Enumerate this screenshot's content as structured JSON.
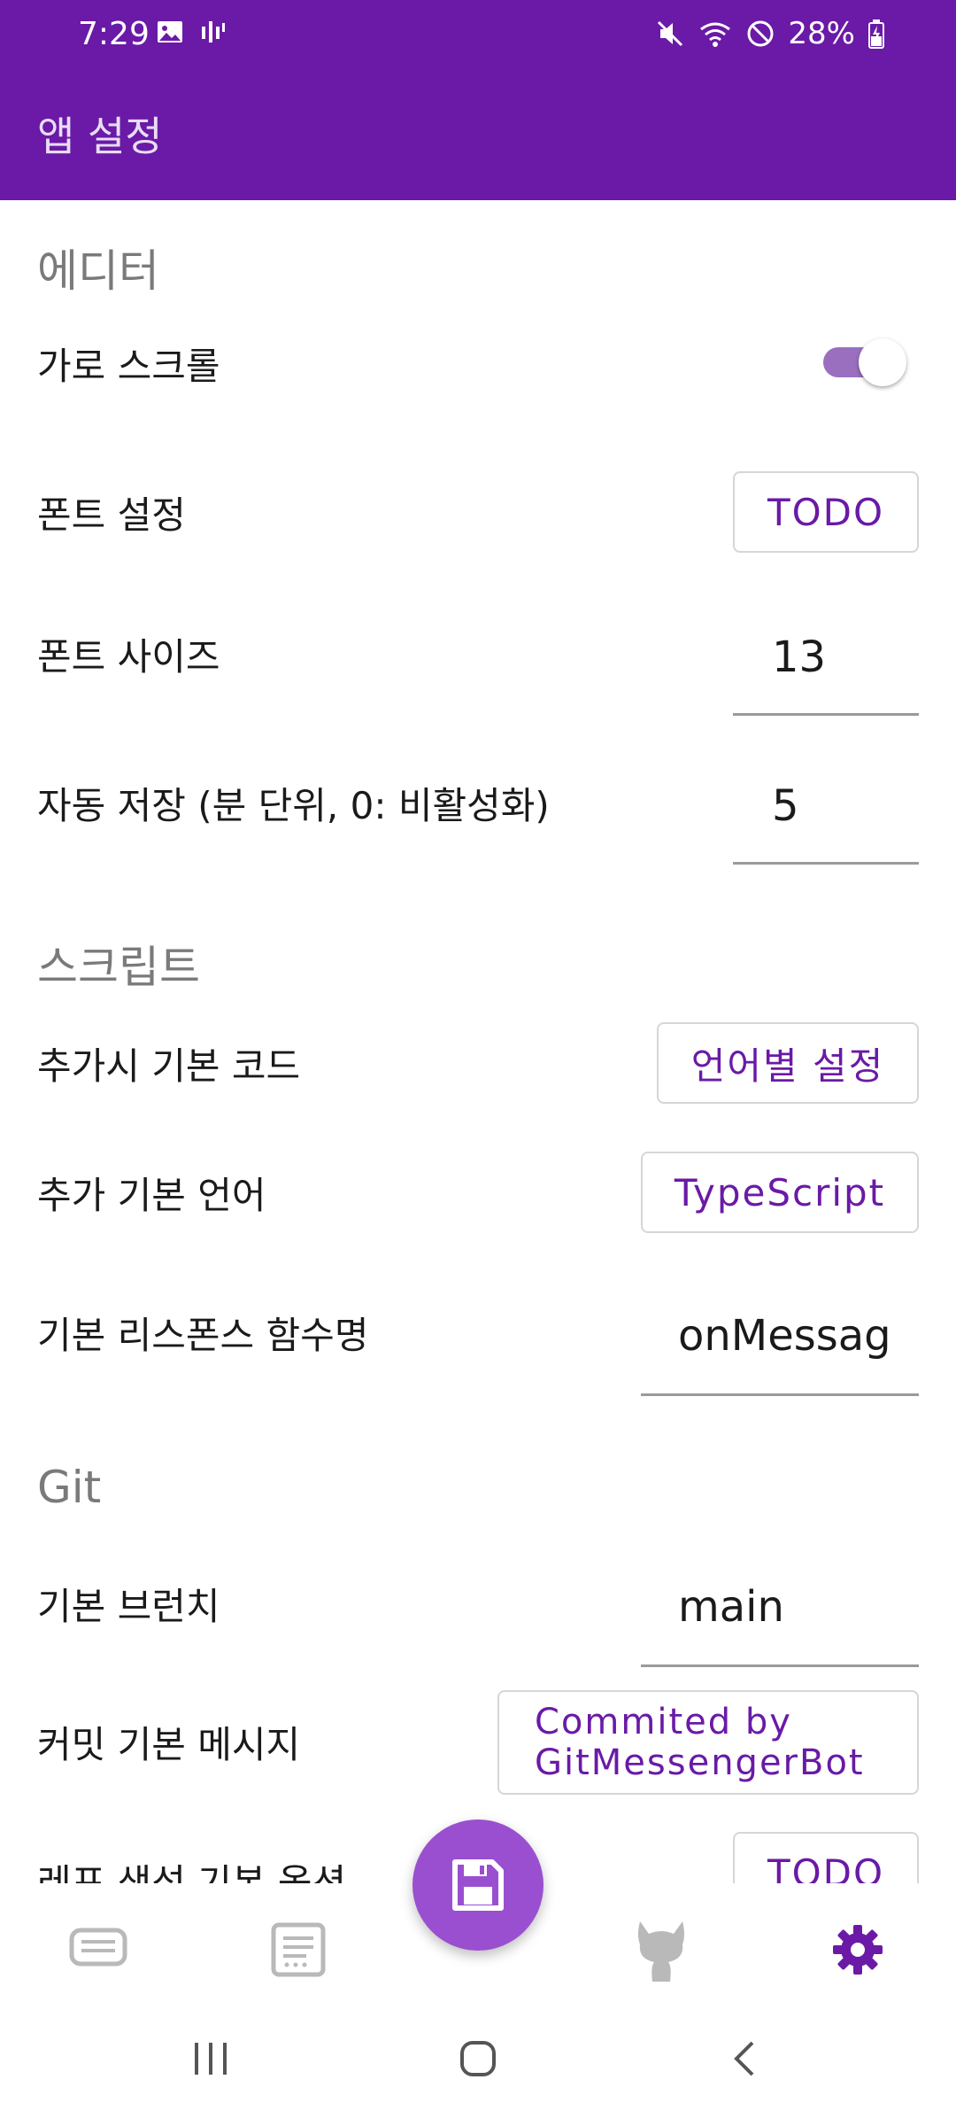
{
  "status_bar": {
    "time": "7:29",
    "battery": "28%"
  },
  "app_bar": {
    "title": "앱 설정"
  },
  "sections": {
    "editor": {
      "header": "에디터",
      "horizontal_scroll_label": "가로 스크롤",
      "horizontal_scroll_enabled": true,
      "font_setting_label": "폰트 설정",
      "font_setting_button": "TODO",
      "font_size_label": "폰트 사이즈",
      "font_size_value": "13",
      "autosave_label": "자동 저장 (분 단위, 0: 비활성화)",
      "autosave_value": "5"
    },
    "script": {
      "header": "스크립트",
      "default_code_label": "추가시 기본 코드",
      "default_code_button": "언어별 설정",
      "default_language_label": "추가 기본 언어",
      "default_language_button": "TypeScript",
      "response_fn_label": "기본 리스폰스 함수명",
      "response_fn_value": "onMessag"
    },
    "git": {
      "header": "Git",
      "default_branch_label": "기본 브런치",
      "default_branch_value": "main",
      "commit_message_label": "커밋 기본 메시지",
      "commit_message_button": "Commited by GitMessengerBot",
      "repo_option_label": "레포 생성 기본 옵션",
      "repo_option_button": "TODO"
    }
  },
  "colors": {
    "primary": "#6a1aa6",
    "fab": "#9a4fd0",
    "section_header": "#7a7a7a"
  },
  "bottom_nav": {
    "items": [
      "list-icon",
      "document-icon",
      "save-icon",
      "github-icon",
      "gear-icon"
    ],
    "active": "gear-icon"
  }
}
